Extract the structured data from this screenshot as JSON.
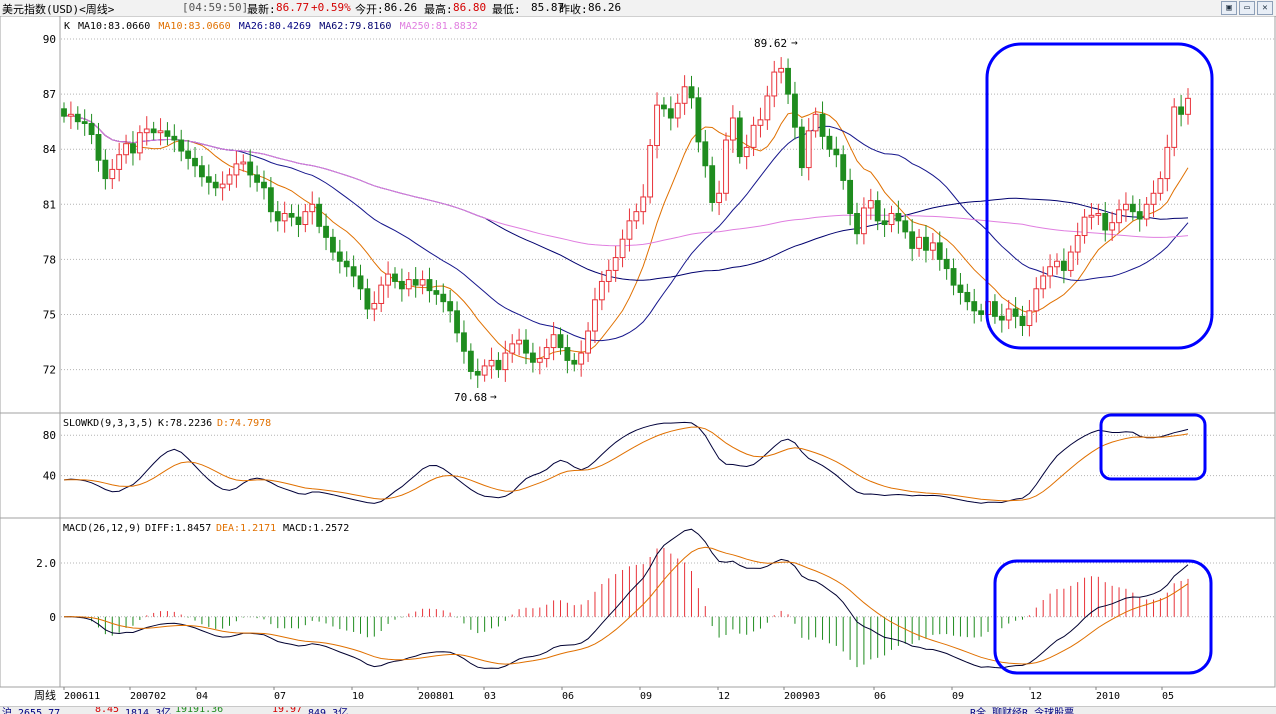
{
  "header": {
    "instrument": "美元指数(USD)<周线>",
    "time": "[04:59:50]",
    "last_label": "最新:",
    "last_value": "86.77",
    "change": "+0.59%",
    "open_label": "今开:",
    "open_value": "86.26",
    "high_label": "最高:",
    "high_value": "86.80",
    "low_label": "最低:",
    "low_value": "85.87",
    "prev_label": "昨收:",
    "prev_value": "86.26"
  },
  "window_buttons": {
    "restore_icon": "restore-icon",
    "minimize_icon": "minimize-icon",
    "close_icon": "close-icon"
  },
  "price_panel": {
    "prefix": "K",
    "ma_labels": [
      {
        "text": "MA10:83.0660",
        "color": "#000000"
      },
      {
        "text": "MA10:83.0660",
        "color": "#e07000"
      },
      {
        "text": "MA26:80.4269",
        "color": "#000080"
      },
      {
        "text": "MA62:79.8160",
        "color": "#00006e"
      },
      {
        "text": "MA250:81.8832",
        "color": "#e07ee0"
      }
    ],
    "max_annotation": "89.62",
    "min_annotation": "70.68"
  },
  "kd_panel": {
    "label": "SLOWKD(9,3,3,5)",
    "k_text": "K:78.2236",
    "d_text": "D:74.7978"
  },
  "macd_panel": {
    "label": "MACD(26,12,9)",
    "diff_text": "DIFF:1.8457",
    "dea_text": "DEA:1.2171",
    "macd_text": "MACD:1.2572"
  },
  "x_axis": {
    "period_label": "周线",
    "ticks": [
      "200611",
      "200702",
      "04",
      "07",
      "10",
      "200801",
      "03",
      "06",
      "09",
      "12",
      "200903",
      "06",
      "09",
      "12",
      "2010",
      "05"
    ]
  },
  "bottom_bar": {
    "items": [
      "沪 2655.77",
      "8.45",
      "1814.3亿",
      "19191.36",
      "19.97",
      "849.3亿",
      "R全 聊财经R 令球股票"
    ]
  },
  "colors": {
    "up": "#e8333a",
    "down": "#1f8c1f",
    "ma10": "#e07000",
    "ma26": "#16168c",
    "ma62": "#00006e",
    "ma250": "#e07ee0",
    "highlight": "#0000ff",
    "grid": "#b4b4b4"
  },
  "chart_data": [
    {
      "type": "candlestick",
      "title": "美元指数(USD)<周线>",
      "ylim": [
        69.8,
        90.6
      ],
      "yticks": [
        72,
        75,
        78,
        81,
        84,
        87,
        90
      ],
      "x_range": [
        "2006-11",
        "2010-06"
      ],
      "closes": [
        85.8,
        85.9,
        85.5,
        85.4,
        84.8,
        83.4,
        82.4,
        82.9,
        83.7,
        84.3,
        83.8,
        84.9,
        85.1,
        84.9,
        85.0,
        84.7,
        84.5,
        83.9,
        83.5,
        83.1,
        82.5,
        82.2,
        81.9,
        82.1,
        82.6,
        83.2,
        83.3,
        82.6,
        82.2,
        81.9,
        80.6,
        80.1,
        80.5,
        80.3,
        79.9,
        80.6,
        81.0,
        79.8,
        79.2,
        78.4,
        77.9,
        77.6,
        77.1,
        76.4,
        75.3,
        75.6,
        76.6,
        77.2,
        76.8,
        76.4,
        76.9,
        76.6,
        76.9,
        76.3,
        76.1,
        75.7,
        75.2,
        74.0,
        73.0,
        71.9,
        71.7,
        72.2,
        72.5,
        72.0,
        72.9,
        73.4,
        73.6,
        72.9,
        72.4,
        72.6,
        73.2,
        73.9,
        73.2,
        72.5,
        72.3,
        72.9,
        74.1,
        75.8,
        76.8,
        77.4,
        78.1,
        79.1,
        80.1,
        80.6,
        81.4,
        84.2,
        86.4,
        86.2,
        85.7,
        86.5,
        87.4,
        86.8,
        84.4,
        83.1,
        81.1,
        81.6,
        84.5,
        85.7,
        83.6,
        84.1,
        85.3,
        85.6,
        86.9,
        88.2,
        88.4,
        87.0,
        85.2,
        83.0,
        85.0,
        85.9,
        84.7,
        84.0,
        83.7,
        82.3,
        80.5,
        79.4,
        80.8,
        81.2,
        80.1,
        79.9,
        80.5,
        80.1,
        79.5,
        78.6,
        79.2,
        78.5,
        78.9,
        78.0,
        77.5,
        76.6,
        76.2,
        75.7,
        75.2,
        75.0,
        75.7,
        74.9,
        74.7,
        75.3,
        74.9,
        74.4,
        75.2,
        76.4,
        77.1,
        77.6,
        77.9,
        77.4,
        78.4,
        79.3,
        80.3,
        80.4,
        80.5,
        79.6,
        80.0,
        80.7,
        81.0,
        80.6,
        80.2,
        81.0,
        81.6,
        82.4,
        84.1,
        86.3,
        85.9,
        86.77
      ],
      "ma10_last": 83.066,
      "ma26_last": 80.4269,
      "ma62_last": 79.816,
      "ma250_last": 81.8832,
      "max_annotation": 89.62,
      "min_annotation": 70.68
    },
    {
      "type": "line",
      "title": "SLOWKD(9,3,3,5)",
      "ylim": [
        0,
        100
      ],
      "yticks": [
        40,
        80
      ],
      "series": [
        {
          "name": "K",
          "last": 78.2236
        },
        {
          "name": "D",
          "last": 74.7978
        }
      ]
    },
    {
      "type": "bar",
      "title": "MACD(26,12,9)",
      "ylim": [
        -2.5,
        3.6
      ],
      "yticks": [
        0,
        2.0
      ],
      "series": [
        {
          "name": "DIFF",
          "last": 1.8457
        },
        {
          "name": "DEA",
          "last": 1.2171
        },
        {
          "name": "MACD",
          "last": 1.2572
        }
      ]
    }
  ]
}
